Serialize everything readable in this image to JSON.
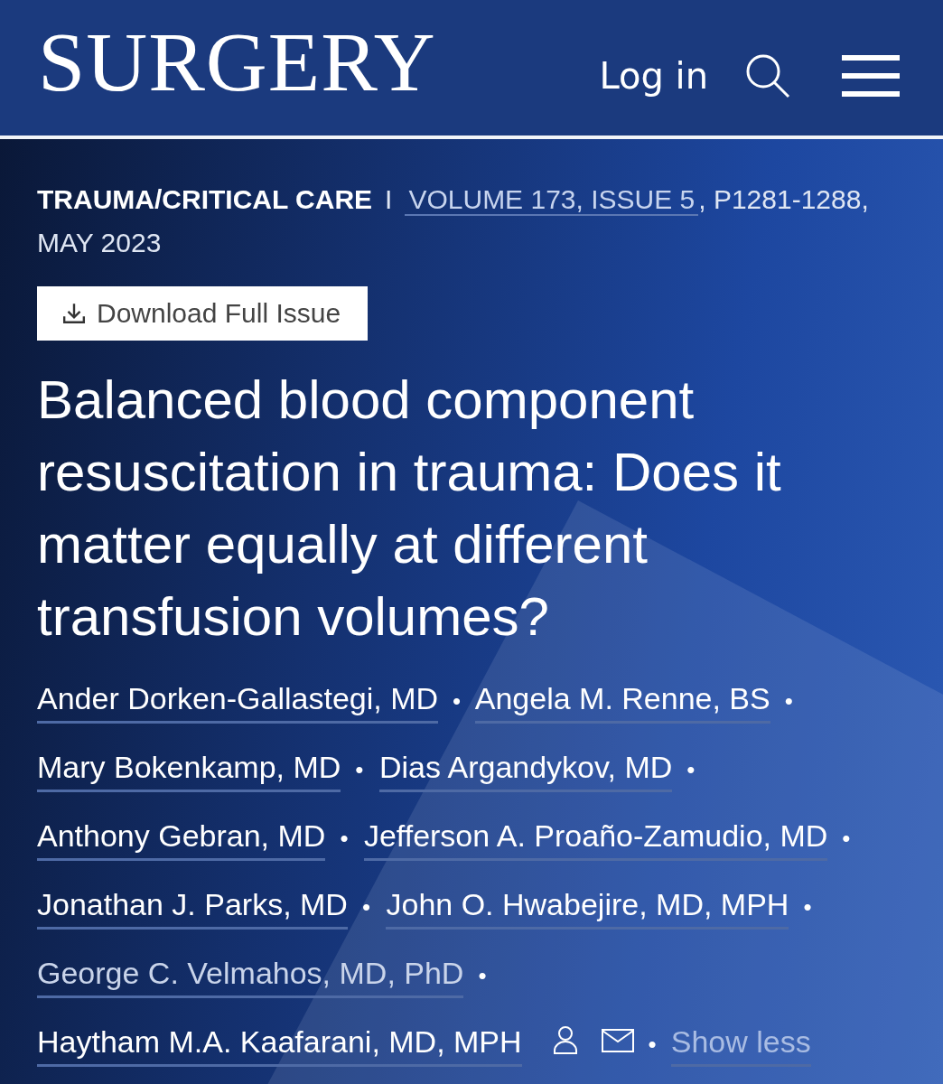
{
  "header": {
    "logo": "SURGERY",
    "login": "Log in"
  },
  "meta": {
    "section": "TRAUMA/CRITICAL CARE",
    "divider": "I",
    "volume": "VOLUME 173, ISSUE 5",
    "pages": ", P1281-1288,",
    "date": "MAY 2023"
  },
  "download_button": "Download Full Issue",
  "title": "Balanced blood component resuscitation in trauma: Does it matter equally at different transfusion volumes?",
  "authors": [
    {
      "name": "Ander Dorken-Gallastegi, MD",
      "visited": false,
      "corresponding": false,
      "separator": "•"
    },
    {
      "name": "Angela M. Renne, BS",
      "visited": false,
      "corresponding": false,
      "separator": "•"
    },
    {
      "name": "Mary Bokenkamp, MD",
      "visited": false,
      "corresponding": false,
      "separator": "•"
    },
    {
      "name": "Dias Argandykov, MD",
      "visited": false,
      "corresponding": false,
      "separator": "•"
    },
    {
      "name": "Anthony Gebran, MD",
      "visited": false,
      "corresponding": false,
      "separator": "•"
    },
    {
      "name": "Jefferson A. Proaño-Zamudio, MD",
      "visited": false,
      "corresponding": false,
      "separator": "•"
    },
    {
      "name": "Jonathan J. Parks, MD",
      "visited": false,
      "corresponding": false,
      "separator": "•"
    },
    {
      "name": "John O. Hwabejire, MD, MPH",
      "visited": false,
      "corresponding": false,
      "separator": "•"
    },
    {
      "name": "George C. Velmahos, MD, PhD",
      "visited": true,
      "corresponding": false,
      "separator": "•"
    },
    {
      "name": "Haytham M.A. Kaafarani, MD, MPH",
      "visited": false,
      "corresponding": true,
      "separator": "•"
    }
  ],
  "show_less": "Show less"
}
